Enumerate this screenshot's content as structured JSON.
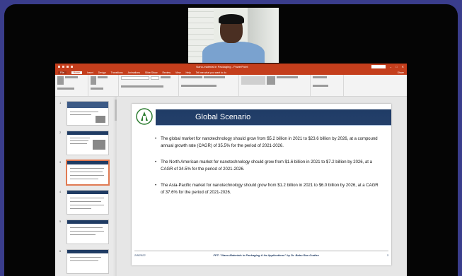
{
  "app": {
    "title": "Nano-material in Packaging - PowerPoint",
    "sign_in": "Sign in",
    "share": "Share"
  },
  "ribbon_tabs": [
    "File",
    "Home",
    "Insert",
    "Design",
    "Transitions",
    "Animations",
    "Slide Show",
    "Review",
    "View",
    "Help",
    "Tell me what you want to do"
  ],
  "thumbnails": [
    "1",
    "2",
    "3",
    "4",
    "5",
    "6"
  ],
  "slide": {
    "title": "Global Scenario",
    "bullets": [
      "The global market for nanotechnology should grow from $5.2 billion in 2021 to $23.6 billion by 2026, at a compound annual growth rate (CAGR) of 35.5% for the period of 2021-2026.",
      "The North American market for nanotechnology should grow from $1.6 billion in 2021 to $7.2 billion by 2026, at a CAGR of 34.5% for the period of 2021-2026.",
      "The Asia-Pacific market for nanotechnology should grow from $1.2 billion in 2021 to $6.0 billion by 2026, at a CAGR of 37.6% for the period of 2021-2026."
    ],
    "footer_date": "2/8/2022",
    "footer_center": "FPT: \"Nano-Materials in Packaging & its Applications\" by Dr. Babu Rao Gudise",
    "page_number": "3"
  },
  "colors": {
    "app_accent": "#c43e1c",
    "slide_banner": "#1f3c66",
    "frame_border": "#3a3d8c"
  }
}
